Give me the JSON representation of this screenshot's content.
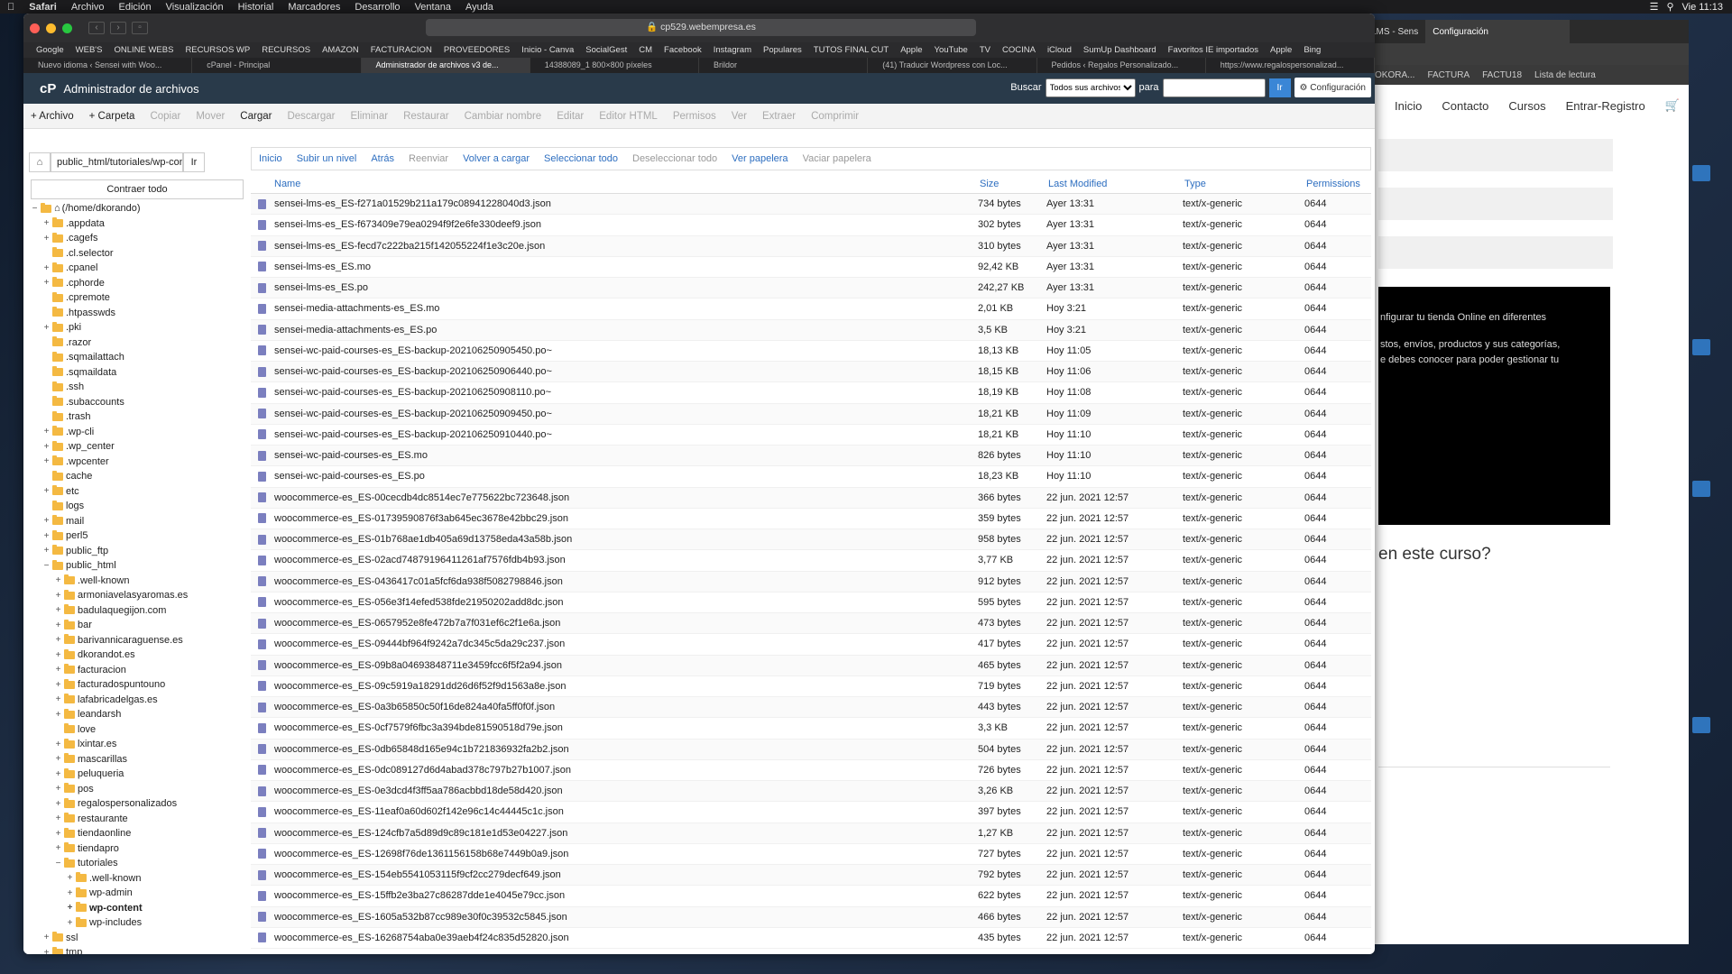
{
  "menubar": {
    "apple": "",
    "items": [
      "Safari",
      "Archivo",
      "Edición",
      "Visualización",
      "Historial",
      "Marcadores",
      "Desarrollo",
      "Ventana",
      "Ayuda"
    ],
    "clock": "Vie 11:13"
  },
  "bg_window": {
    "tab_partial": "LMS - Sens",
    "tab_config": "Configuración",
    "bookmarks": [
      "OKORA...",
      "FACTURA",
      "FACTU18",
      "Lista de lectura"
    ],
    "nav": [
      "Inicio",
      "Contacto",
      "Cursos",
      "Entrar-Registro"
    ],
    "black_text1": "nfigurar tu tienda Online en diferentes",
    "black_text2": "stos, envíos, productos y sus categorías,",
    "black_text3": "e debes conocer para poder gestionar tu",
    "question": "en este curso?"
  },
  "browser": {
    "url": "cp529.webempresa.es",
    "bookmarks": [
      "Google",
      "WEB'S",
      "ONLINE WEBS",
      "RECURSOS WP",
      "RECURSOS",
      "AMAZON",
      "FACTURACION",
      "PROVEEDORES",
      "Inicio - Canva",
      "SocialGest",
      "CM",
      "Facebook",
      "Instagram",
      "Populares",
      "TUTOS FINAL CUT",
      "Apple",
      "YouTube",
      "TV",
      "COCINA",
      "iCloud",
      "SumUp Dashboard",
      "Favoritos IE importados",
      "Apple",
      "Bing"
    ],
    "tabs": [
      "Nuevo idioma ‹ Sensei with Woo...",
      "cPanel - Principal",
      "Administrador de archivos v3 de...",
      "14388089_1 800×800 píxeles",
      "Brildor",
      "(41) Traducir Wordpress con Loc...",
      "Pedidos ‹ Regalos Personalizado...",
      "https://www.regalospersonalizad..."
    ]
  },
  "cpanel": {
    "logo": "cP",
    "title": "Administrador de archivos",
    "search_label": "Buscar",
    "search_scope": "Todos sus archivos",
    "for_label": "para",
    "go": "Ir",
    "settings": "Configuración"
  },
  "toolbar": [
    {
      "label": "+ Archivo",
      "on": true
    },
    {
      "label": "+ Carpeta",
      "on": true
    },
    {
      "label": "Copiar",
      "on": false
    },
    {
      "label": "Mover",
      "on": false
    },
    {
      "label": "Cargar",
      "on": true
    },
    {
      "label": "Descargar",
      "on": false
    },
    {
      "label": "Eliminar",
      "on": false
    },
    {
      "label": "Restaurar",
      "on": false
    },
    {
      "label": "Cambiar nombre",
      "on": false
    },
    {
      "label": "Editar",
      "on": false
    },
    {
      "label": "Editor HTML",
      "on": false
    },
    {
      "label": "Permisos",
      "on": false
    },
    {
      "label": "Ver",
      "on": false
    },
    {
      "label": "Extraer",
      "on": false
    },
    {
      "label": "Comprimir",
      "on": false
    }
  ],
  "left": {
    "path": "public_html/tutoriales/wp-conte",
    "go": "Ir",
    "collapse": "Contraer todo"
  },
  "tree": [
    {
      "d": 0,
      "t": "(/home/dkorando)",
      "pm": "−",
      "home": true
    },
    {
      "d": 1,
      "t": ".appdata",
      "pm": "+"
    },
    {
      "d": 1,
      "t": ".cagefs",
      "pm": "+"
    },
    {
      "d": 1,
      "t": ".cl.selector",
      "pm": ""
    },
    {
      "d": 1,
      "t": ".cpanel",
      "pm": "+"
    },
    {
      "d": 1,
      "t": ".cphorde",
      "pm": "+"
    },
    {
      "d": 1,
      "t": ".cpremote",
      "pm": ""
    },
    {
      "d": 1,
      "t": ".htpasswds",
      "pm": ""
    },
    {
      "d": 1,
      "t": ".pki",
      "pm": "+"
    },
    {
      "d": 1,
      "t": ".razor",
      "pm": ""
    },
    {
      "d": 1,
      "t": ".sqmailattach",
      "pm": ""
    },
    {
      "d": 1,
      "t": ".sqmaildata",
      "pm": ""
    },
    {
      "d": 1,
      "t": ".ssh",
      "pm": ""
    },
    {
      "d": 1,
      "t": ".subaccounts",
      "pm": ""
    },
    {
      "d": 1,
      "t": ".trash",
      "pm": ""
    },
    {
      "d": 1,
      "t": ".wp-cli",
      "pm": "+"
    },
    {
      "d": 1,
      "t": ".wp_center",
      "pm": "+"
    },
    {
      "d": 1,
      "t": ".wpcenter",
      "pm": "+"
    },
    {
      "d": 1,
      "t": "cache",
      "pm": ""
    },
    {
      "d": 1,
      "t": "etc",
      "pm": "+"
    },
    {
      "d": 1,
      "t": "logs",
      "pm": ""
    },
    {
      "d": 1,
      "t": "mail",
      "pm": "+"
    },
    {
      "d": 1,
      "t": "perl5",
      "pm": "+"
    },
    {
      "d": 1,
      "t": "public_ftp",
      "pm": "+"
    },
    {
      "d": 1,
      "t": "public_html",
      "pm": "−"
    },
    {
      "d": 2,
      "t": ".well-known",
      "pm": "+"
    },
    {
      "d": 2,
      "t": "armoniavelasyaromas.es",
      "pm": "+"
    },
    {
      "d": 2,
      "t": "badulaquegijon.com",
      "pm": "+"
    },
    {
      "d": 2,
      "t": "bar",
      "pm": "+"
    },
    {
      "d": 2,
      "t": "barivannicaraguense.es",
      "pm": "+"
    },
    {
      "d": 2,
      "t": "dkorandot.es",
      "pm": "+"
    },
    {
      "d": 2,
      "t": "facturacion",
      "pm": "+"
    },
    {
      "d": 2,
      "t": "facturadospuntouno",
      "pm": "+"
    },
    {
      "d": 2,
      "t": "lafabricadelgas.es",
      "pm": "+"
    },
    {
      "d": 2,
      "t": "leandarsh",
      "pm": "+"
    },
    {
      "d": 2,
      "t": "love",
      "pm": ""
    },
    {
      "d": 2,
      "t": "lxintar.es",
      "pm": "+"
    },
    {
      "d": 2,
      "t": "mascarillas",
      "pm": "+"
    },
    {
      "d": 2,
      "t": "peluqueria",
      "pm": "+"
    },
    {
      "d": 2,
      "t": "pos",
      "pm": "+"
    },
    {
      "d": 2,
      "t": "regalospersonalizados",
      "pm": "+"
    },
    {
      "d": 2,
      "t": "restaurante",
      "pm": "+"
    },
    {
      "d": 2,
      "t": "tiendaonline",
      "pm": "+"
    },
    {
      "d": 2,
      "t": "tiendapro",
      "pm": "+"
    },
    {
      "d": 2,
      "t": "tutoriales",
      "pm": "−"
    },
    {
      "d": 3,
      "t": ".well-known",
      "pm": "+"
    },
    {
      "d": 3,
      "t": "wp-admin",
      "pm": "+"
    },
    {
      "d": 3,
      "t": "wp-content",
      "pm": "+",
      "cur": true
    },
    {
      "d": 3,
      "t": "wp-includes",
      "pm": "+"
    },
    {
      "d": 1,
      "t": "ssl",
      "pm": "+"
    },
    {
      "d": 1,
      "t": "tmp",
      "pm": "+"
    }
  ],
  "navbar": [
    {
      "label": "Inicio",
      "on": true
    },
    {
      "label": "Subir un nivel",
      "on": true
    },
    {
      "label": "Atrás",
      "on": true
    },
    {
      "label": "Reenviar",
      "on": false
    },
    {
      "label": "Volver a cargar",
      "on": true
    },
    {
      "label": "Seleccionar todo",
      "on": true
    },
    {
      "label": "Deseleccionar todo",
      "on": false
    },
    {
      "label": "Ver papelera",
      "on": true
    },
    {
      "label": "Vaciar papelera",
      "on": false
    }
  ],
  "columns": [
    "Name",
    "Size",
    "Last Modified",
    "Type",
    "Permissions"
  ],
  "files": [
    [
      "sensei-lms-es_ES-f271a01529b211a179c08941228040d3.json",
      "734 bytes",
      "Ayer 13:31",
      "text/x-generic",
      "0644"
    ],
    [
      "sensei-lms-es_ES-f673409e79ea0294f9f2e6fe330deef9.json",
      "302 bytes",
      "Ayer 13:31",
      "text/x-generic",
      "0644"
    ],
    [
      "sensei-lms-es_ES-fecd7c222ba215f142055224f1e3c20e.json",
      "310 bytes",
      "Ayer 13:31",
      "text/x-generic",
      "0644"
    ],
    [
      "sensei-lms-es_ES.mo",
      "92,42 KB",
      "Ayer 13:31",
      "text/x-generic",
      "0644"
    ],
    [
      "sensei-lms-es_ES.po",
      "242,27 KB",
      "Ayer 13:31",
      "text/x-generic",
      "0644"
    ],
    [
      "sensei-media-attachments-es_ES.mo",
      "2,01 KB",
      "Hoy 3:21",
      "text/x-generic",
      "0644"
    ],
    [
      "sensei-media-attachments-es_ES.po",
      "3,5 KB",
      "Hoy 3:21",
      "text/x-generic",
      "0644"
    ],
    [
      "sensei-wc-paid-courses-es_ES-backup-202106250905450.po~",
      "18,13 KB",
      "Hoy 11:05",
      "text/x-generic",
      "0644"
    ],
    [
      "sensei-wc-paid-courses-es_ES-backup-202106250906440.po~",
      "18,15 KB",
      "Hoy 11:06",
      "text/x-generic",
      "0644"
    ],
    [
      "sensei-wc-paid-courses-es_ES-backup-202106250908110.po~",
      "18,19 KB",
      "Hoy 11:08",
      "text/x-generic",
      "0644"
    ],
    [
      "sensei-wc-paid-courses-es_ES-backup-202106250909450.po~",
      "18,21 KB",
      "Hoy 11:09",
      "text/x-generic",
      "0644"
    ],
    [
      "sensei-wc-paid-courses-es_ES-backup-202106250910440.po~",
      "18,21 KB",
      "Hoy 11:10",
      "text/x-generic",
      "0644"
    ],
    [
      "sensei-wc-paid-courses-es_ES.mo",
      "826 bytes",
      "Hoy 11:10",
      "text/x-generic",
      "0644"
    ],
    [
      "sensei-wc-paid-courses-es_ES.po",
      "18,23 KB",
      "Hoy 11:10",
      "text/x-generic",
      "0644"
    ],
    [
      "woocommerce-es_ES-00cecdb4dc8514ec7e775622bc723648.json",
      "366 bytes",
      "22 jun. 2021 12:57",
      "text/x-generic",
      "0644"
    ],
    [
      "woocommerce-es_ES-01739590876f3ab645ec3678e42bbc29.json",
      "359 bytes",
      "22 jun. 2021 12:57",
      "text/x-generic",
      "0644"
    ],
    [
      "woocommerce-es_ES-01b768ae1db405a69d13758eda43a58b.json",
      "958 bytes",
      "22 jun. 2021 12:57",
      "text/x-generic",
      "0644"
    ],
    [
      "woocommerce-es_ES-02acd74879196411261af7576fdb4b93.json",
      "3,77 KB",
      "22 jun. 2021 12:57",
      "text/x-generic",
      "0644"
    ],
    [
      "woocommerce-es_ES-0436417c01a5fcf6da938f5082798846.json",
      "912 bytes",
      "22 jun. 2021 12:57",
      "text/x-generic",
      "0644"
    ],
    [
      "woocommerce-es_ES-056e3f14efed538fde21950202add8dc.json",
      "595 bytes",
      "22 jun. 2021 12:57",
      "text/x-generic",
      "0644"
    ],
    [
      "woocommerce-es_ES-0657952e8fe472b7a7f031ef6c2f1e6a.json",
      "473 bytes",
      "22 jun. 2021 12:57",
      "text/x-generic",
      "0644"
    ],
    [
      "woocommerce-es_ES-09444bf964f9242a7dc345c5da29c237.json",
      "417 bytes",
      "22 jun. 2021 12:57",
      "text/x-generic",
      "0644"
    ],
    [
      "woocommerce-es_ES-09b8a04693848711e3459fcc6f5f2a94.json",
      "465 bytes",
      "22 jun. 2021 12:57",
      "text/x-generic",
      "0644"
    ],
    [
      "woocommerce-es_ES-09c5919a18291dd26d6f52f9d1563a8e.json",
      "719 bytes",
      "22 jun. 2021 12:57",
      "text/x-generic",
      "0644"
    ],
    [
      "woocommerce-es_ES-0a3b65850c50f16de824a40fa5ff0f0f.json",
      "443 bytes",
      "22 jun. 2021 12:57",
      "text/x-generic",
      "0644"
    ],
    [
      "woocommerce-es_ES-0cf7579f6fbc3a394bde81590518d79e.json",
      "3,3 KB",
      "22 jun. 2021 12:57",
      "text/x-generic",
      "0644"
    ],
    [
      "woocommerce-es_ES-0db65848d165e94c1b721836932fa2b2.json",
      "504 bytes",
      "22 jun. 2021 12:57",
      "text/x-generic",
      "0644"
    ],
    [
      "woocommerce-es_ES-0dc089127d6d4abad378c797b27b1007.json",
      "726 bytes",
      "22 jun. 2021 12:57",
      "text/x-generic",
      "0644"
    ],
    [
      "woocommerce-es_ES-0e3dcd4f3ff5aa786acbbd18de58d420.json",
      "3,26 KB",
      "22 jun. 2021 12:57",
      "text/x-generic",
      "0644"
    ],
    [
      "woocommerce-es_ES-11eaf0a60d602f142e96c14c44445c1c.json",
      "397 bytes",
      "22 jun. 2021 12:57",
      "text/x-generic",
      "0644"
    ],
    [
      "woocommerce-es_ES-124cfb7a5d89d9c89c181e1d53e04227.json",
      "1,27 KB",
      "22 jun. 2021 12:57",
      "text/x-generic",
      "0644"
    ],
    [
      "woocommerce-es_ES-12698f76de1361156158b68e7449b0a9.json",
      "727 bytes",
      "22 jun. 2021 12:57",
      "text/x-generic",
      "0644"
    ],
    [
      "woocommerce-es_ES-154eb5541053115f9cf2cc279decf649.json",
      "792 bytes",
      "22 jun. 2021 12:57",
      "text/x-generic",
      "0644"
    ],
    [
      "woocommerce-es_ES-15ffb2e3ba27c86287dde1e4045e79cc.json",
      "622 bytes",
      "22 jun. 2021 12:57",
      "text/x-generic",
      "0644"
    ],
    [
      "woocommerce-es_ES-1605a532b87cc989e30f0c39532c5845.json",
      "466 bytes",
      "22 jun. 2021 12:57",
      "text/x-generic",
      "0644"
    ],
    [
      "woocommerce-es_ES-16268754aba0e39aeb4f24c835d52820.json",
      "435 bytes",
      "22 jun. 2021 12:57",
      "text/x-generic",
      "0644"
    ]
  ],
  "colors": {
    "cpanel_header": "#293a4a",
    "link": "#2d6ec0",
    "folder": "#f4b942",
    "file": "#7b7fbf"
  }
}
